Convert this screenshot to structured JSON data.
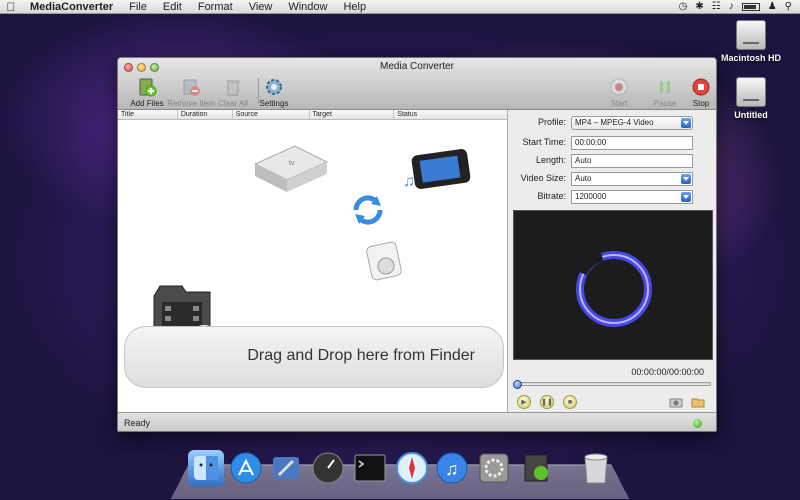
{
  "menubar": {
    "app_name": "MediaConverter",
    "menus": [
      "File",
      "Edit",
      "Format",
      "View",
      "Window",
      "Help"
    ]
  },
  "desktop": {
    "icons": [
      {
        "label": "Macintosh HD",
        "icon": "hard-drive-icon"
      },
      {
        "label": "Untitled",
        "icon": "hard-drive-icon"
      }
    ]
  },
  "window": {
    "title": "Media Converter",
    "toolbar": {
      "add_files": "Add Files",
      "remove_item": "Remove Item",
      "clear_all": "Clear All",
      "settings": "Settings",
      "start": "Start",
      "pause": "Pause",
      "stop": "Stop"
    },
    "columns": [
      "Title",
      "Duration",
      "Source",
      "Target",
      "Status"
    ],
    "drop_text": "Drag and Drop here from Finder",
    "settings_panel": {
      "profile_label": "Profile:",
      "profile_value": "MP4 – MPEG-4 Video",
      "start_time_label": "Start Time:",
      "start_time_value": "00:00:00",
      "length_label": "Length:",
      "length_value": "Auto",
      "video_size_label": "Video Size:",
      "video_size_value": "Auto",
      "bitrate_label": "Bitrate:",
      "bitrate_value": "1200000"
    },
    "player": {
      "timecode": "00:00:00/00:00:00",
      "seek_fraction": 0.0
    },
    "status": "Ready"
  },
  "colors": {
    "accent_blue": "#2761c7",
    "status_green": "#2e9a1c",
    "stop_red": "#e0443a"
  }
}
